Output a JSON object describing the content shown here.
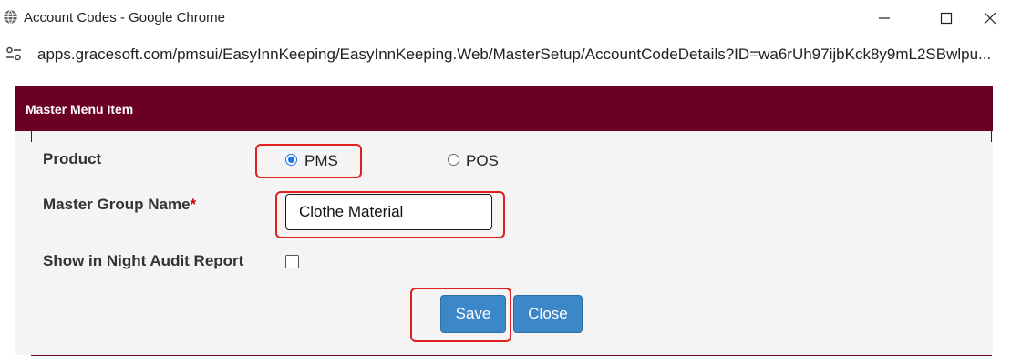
{
  "window": {
    "title": "Account Codes - Google Chrome"
  },
  "address_bar": {
    "url": "apps.gracesoft.com/pmsui/EasyInnKeeping/EasyInnKeeping.Web/MasterSetup/AccountCodeDetails?ID=wa6rUh97ijbKck8y9mL2SBwlpu..."
  },
  "dialog": {
    "title": "Master Menu Item",
    "product": {
      "label": "Product",
      "options": [
        {
          "label": "PMS",
          "selected": true
        },
        {
          "label": "POS",
          "selected": false
        }
      ]
    },
    "master_group": {
      "label": "Master Group Name",
      "required_mark": "*",
      "value": "Clothe Material"
    },
    "night_audit": {
      "label": "Show in Night Audit Report",
      "checked": false
    },
    "buttons": {
      "save": "Save",
      "close": "Close"
    }
  },
  "colors": {
    "header_bg": "#6b0023",
    "button_bg": "#3c87c8",
    "highlight": "#e02020"
  }
}
